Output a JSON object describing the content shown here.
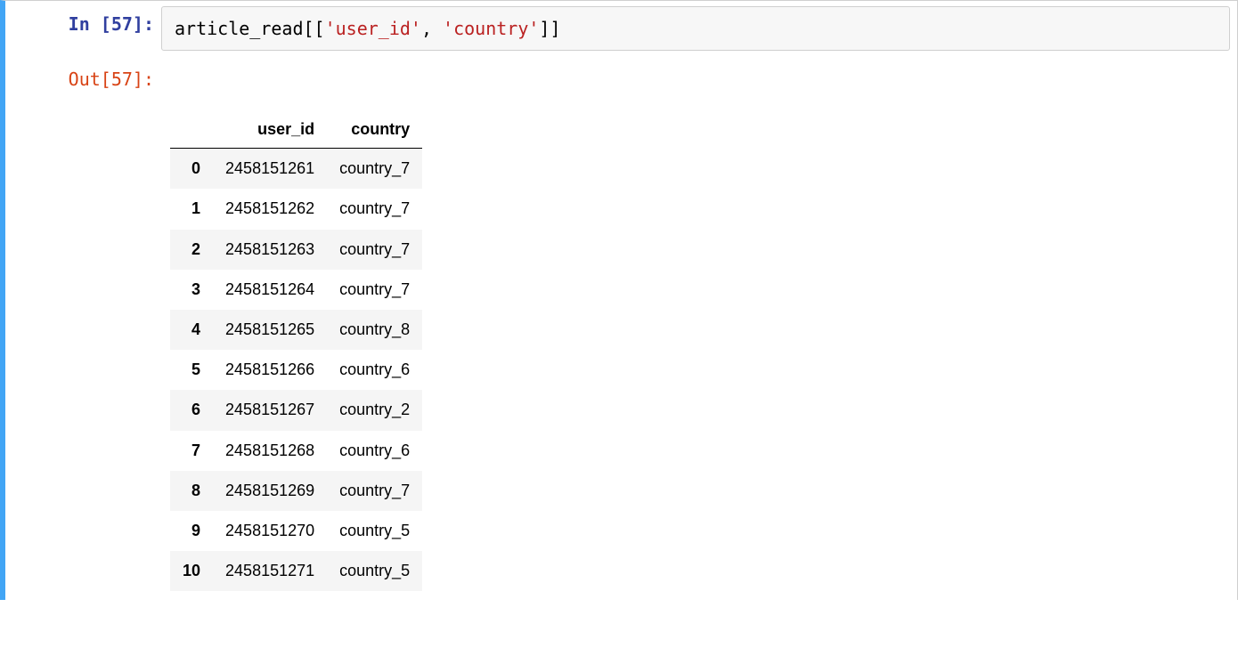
{
  "cell": {
    "in_prompt": "In [57]:",
    "out_prompt": "Out[57]:",
    "code": {
      "p1": "article_read[[",
      "s1": "'user_id'",
      "p2": ", ",
      "s2": "'country'",
      "p3": "]]"
    }
  },
  "chart_data": {
    "type": "table",
    "columns": [
      "user_id",
      "country"
    ],
    "index": [
      "0",
      "1",
      "2",
      "3",
      "4",
      "5",
      "6",
      "7",
      "8",
      "9",
      "10"
    ],
    "rows": [
      {
        "idx": "0",
        "user_id": "2458151261",
        "country": "country_7"
      },
      {
        "idx": "1",
        "user_id": "2458151262",
        "country": "country_7"
      },
      {
        "idx": "2",
        "user_id": "2458151263",
        "country": "country_7"
      },
      {
        "idx": "3",
        "user_id": "2458151264",
        "country": "country_7"
      },
      {
        "idx": "4",
        "user_id": "2458151265",
        "country": "country_8"
      },
      {
        "idx": "5",
        "user_id": "2458151266",
        "country": "country_6"
      },
      {
        "idx": "6",
        "user_id": "2458151267",
        "country": "country_2"
      },
      {
        "idx": "7",
        "user_id": "2458151268",
        "country": "country_6"
      },
      {
        "idx": "8",
        "user_id": "2458151269",
        "country": "country_7"
      },
      {
        "idx": "9",
        "user_id": "2458151270",
        "country": "country_5"
      },
      {
        "idx": "10",
        "user_id": "2458151271",
        "country": "country_5"
      }
    ]
  }
}
